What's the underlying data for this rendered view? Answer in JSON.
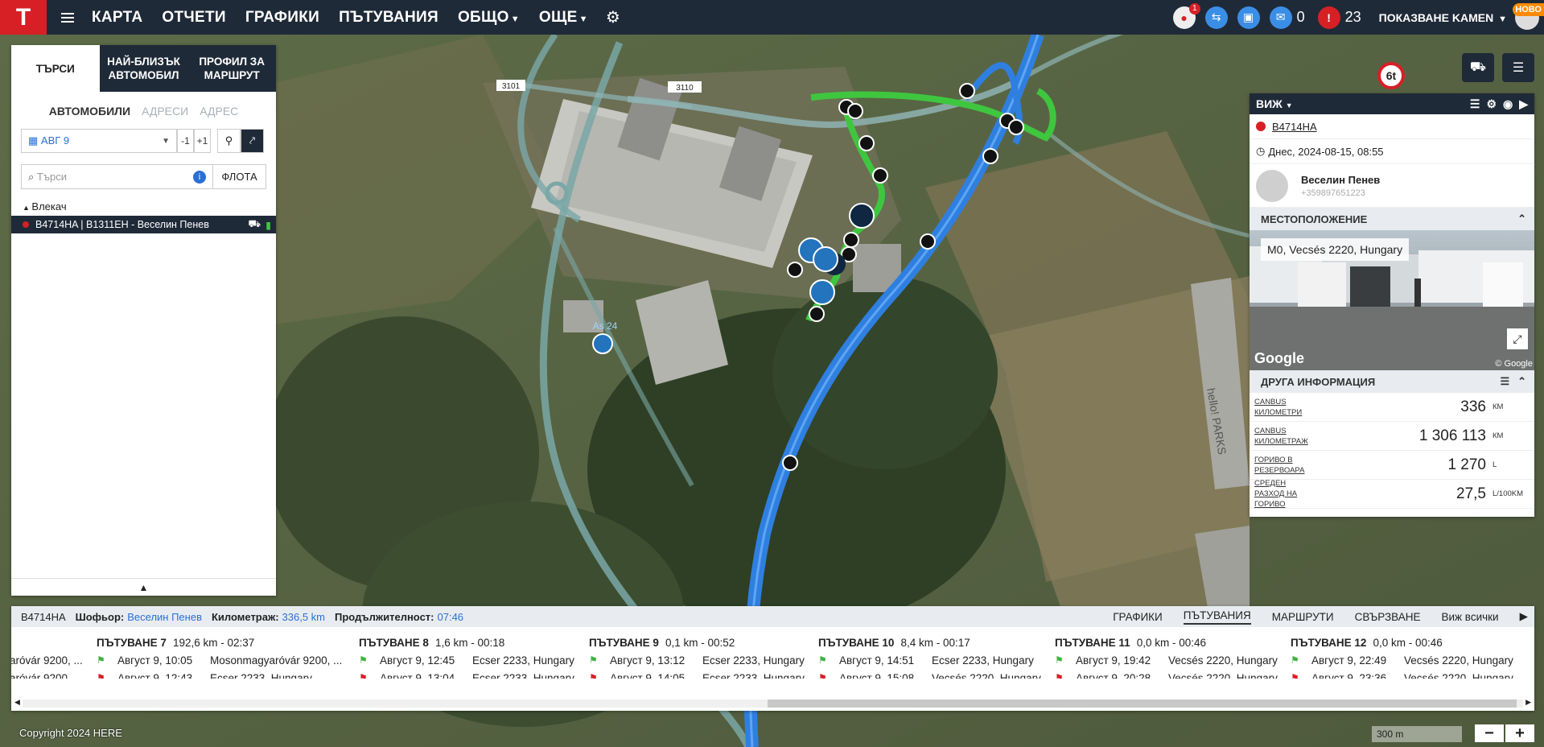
{
  "topbar": {
    "logo": "T",
    "nav": [
      {
        "label": "КАРТА"
      },
      {
        "label": "ОТЧЕТИ"
      },
      {
        "label": "ГРАФИКИ"
      },
      {
        "label": "ПЪТУВАНИЯ"
      },
      {
        "label": "ОБЩО",
        "dropdown": true
      },
      {
        "label": "ОЩЕ",
        "dropdown": true
      }
    ],
    "alerts_badge": "1",
    "messages_count": "0",
    "warnings_count": "23",
    "user_label": "ПОКАЗВАНЕ KAMEN",
    "new_badge": "НОВО"
  },
  "map": {
    "road_labels": [
      "3101",
      "3110"
    ],
    "poi_label": "As 24",
    "billboard_text": "hello! PARKS",
    "speed_limit": "6t",
    "copyright": "Copyright 2024 HERE",
    "scale": "300 m",
    "zoom_in": "+",
    "zoom_out": "−"
  },
  "left_panel": {
    "tabs": [
      {
        "label": "ТЪРСИ",
        "active": true
      },
      {
        "label": "НАЙ-БЛИЗЪК АВТОМОБИЛ"
      },
      {
        "label": "ПРОФИЛ ЗА МАРШРУТ"
      }
    ],
    "subtabs": [
      {
        "label": "АВТОМОБИЛИ",
        "active": true
      },
      {
        "label": "АДРЕСИ"
      },
      {
        "label": "АДРЕС"
      }
    ],
    "date": "АВГ 9",
    "minus_btn": "-1",
    "plus_btn": "+1",
    "search_placeholder": "Търси",
    "fleet_btn": "ФЛОТА",
    "group_label": "Влекач",
    "vehicle": "B4714HA | B1311EH - Веселин Пенев"
  },
  "right_panel": {
    "view_label": "ВИЖ",
    "plate": "B4714HA",
    "timestamp": "Днес, 2024-08-15, 08:55",
    "driver_name": "Веселин Пенев",
    "driver_phone": "+359897651223",
    "location_header": "МЕСТОПОЛОЖЕНИЕ",
    "address": "M0, Vecsés 2220, Hungary",
    "streetview_brand": "Google",
    "streetview_copy": "© Google",
    "other_info_header": "ДРУГА ИНФОРМАЦИЯ",
    "info_rows": [
      {
        "label1": "CANBUS",
        "label2": "КИЛОМЕТРИ",
        "value": "336",
        "unit": "КМ"
      },
      {
        "label1": "CANBUS",
        "label2": "КИЛОМЕТРАЖ",
        "value": "1 306 113",
        "unit": "КМ"
      },
      {
        "label1": "ГОРИВО В",
        "label2": "РЕЗЕРВОАРА",
        "value": "1 270",
        "unit": "L"
      },
      {
        "label1": "СРЕДЕН",
        "label2": "РАЗХОД НА ГОРИВО",
        "value": "27,5",
        "unit": "L/100KM"
      }
    ]
  },
  "bottom_panel": {
    "plate": "B4714HA",
    "driver_key": "Шофьор:",
    "driver_val": "Веселин Пенев",
    "mileage_key": "Километраж:",
    "mileage_val": "336,5 km",
    "duration_key": "Продължителност:",
    "duration_val": "07:46",
    "tabs": [
      {
        "label": "ГРАФИКИ"
      },
      {
        "label": "ПЪТУВАНИЯ",
        "active": true
      },
      {
        "label": "МАРШРУТИ"
      },
      {
        "label": "СВЪРЗВАНЕ"
      },
      {
        "label": "Виж всички"
      }
    ],
    "partial_trip": {
      "start_addr": "aróvár 9200, ...",
      "end_addr": "aróvár 9200, ..."
    },
    "trips": [
      {
        "title": "ПЪТУВАНЕ 7",
        "meta": "192,6 km - 02:37",
        "start_date": "Август 9, 10:05",
        "start_addr": "Mosonmagyaróvár 9200, ...",
        "end_date": "Август 9, 12:43",
        "end_addr": "Ecser 2233, Hungary"
      },
      {
        "title": "ПЪТУВАНЕ 8",
        "meta": "1,6 km - 00:18",
        "start_date": "Август 9, 12:45",
        "start_addr": "Ecser 2233, Hungary",
        "end_date": "Август 9, 13:04",
        "end_addr": "Ecser 2233, Hungary"
      },
      {
        "title": "ПЪТУВАНЕ 9",
        "meta": "0,1 km - 00:52",
        "start_date": "Август 9, 13:12",
        "start_addr": "Ecser 2233, Hungary",
        "end_date": "Август 9, 14:05",
        "end_addr": "Ecser 2233, Hungary"
      },
      {
        "title": "ПЪТУВАНЕ 10",
        "meta": "8,4 km - 00:17",
        "start_date": "Август 9, 14:51",
        "start_addr": "Ecser 2233, Hungary",
        "end_date": "Август 9, 15:08",
        "end_addr": "Vecsés 2220, Hungary"
      },
      {
        "title": "ПЪТУВАНЕ 11",
        "meta": "0,0 km - 00:46",
        "start_date": "Август 9, 19:42",
        "start_addr": "Vecsés 2220, Hungary",
        "end_date": "Август 9, 20:28",
        "end_addr": "Vecsés 2220, Hungary"
      },
      {
        "title": "ПЪТУВАНЕ 12",
        "meta": "0,0 km - 00:46",
        "start_date": "Август 9, 22:49",
        "start_addr": "Vecsés 2220, Hungary",
        "end_date": "Август 9, 23:36",
        "end_addr": "Vecsés 2220, Hungary"
      }
    ]
  },
  "colors": {
    "brand_red": "#d71f26",
    "navy": "#1f2a38",
    "link_blue": "#2a6fd6",
    "route_green": "#3fc63f",
    "route_blue": "#2f7fe0"
  }
}
